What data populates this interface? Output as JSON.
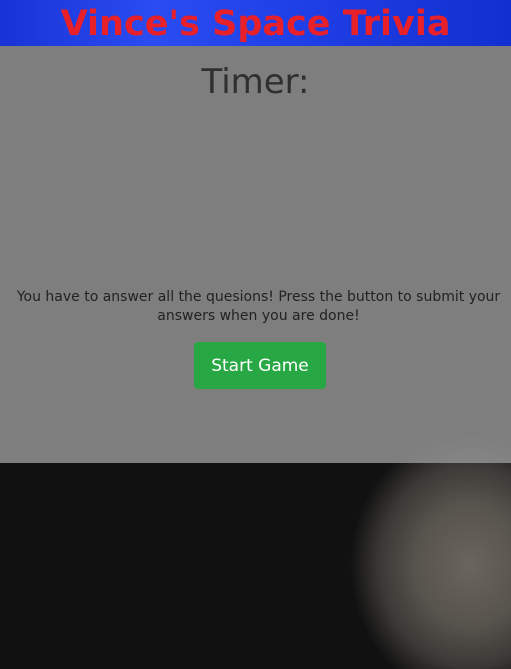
{
  "header": {
    "title": "Vince's Space Trivia"
  },
  "main": {
    "timer_label": "Timer:",
    "instructions": "You have to answer all the quesions! Press the button to submit your answers when you are done!",
    "start_button_label": "Start Game"
  },
  "colors": {
    "header_bg": "#1f3fe6",
    "title_text": "#e8202a",
    "button_bg": "#28a745"
  }
}
